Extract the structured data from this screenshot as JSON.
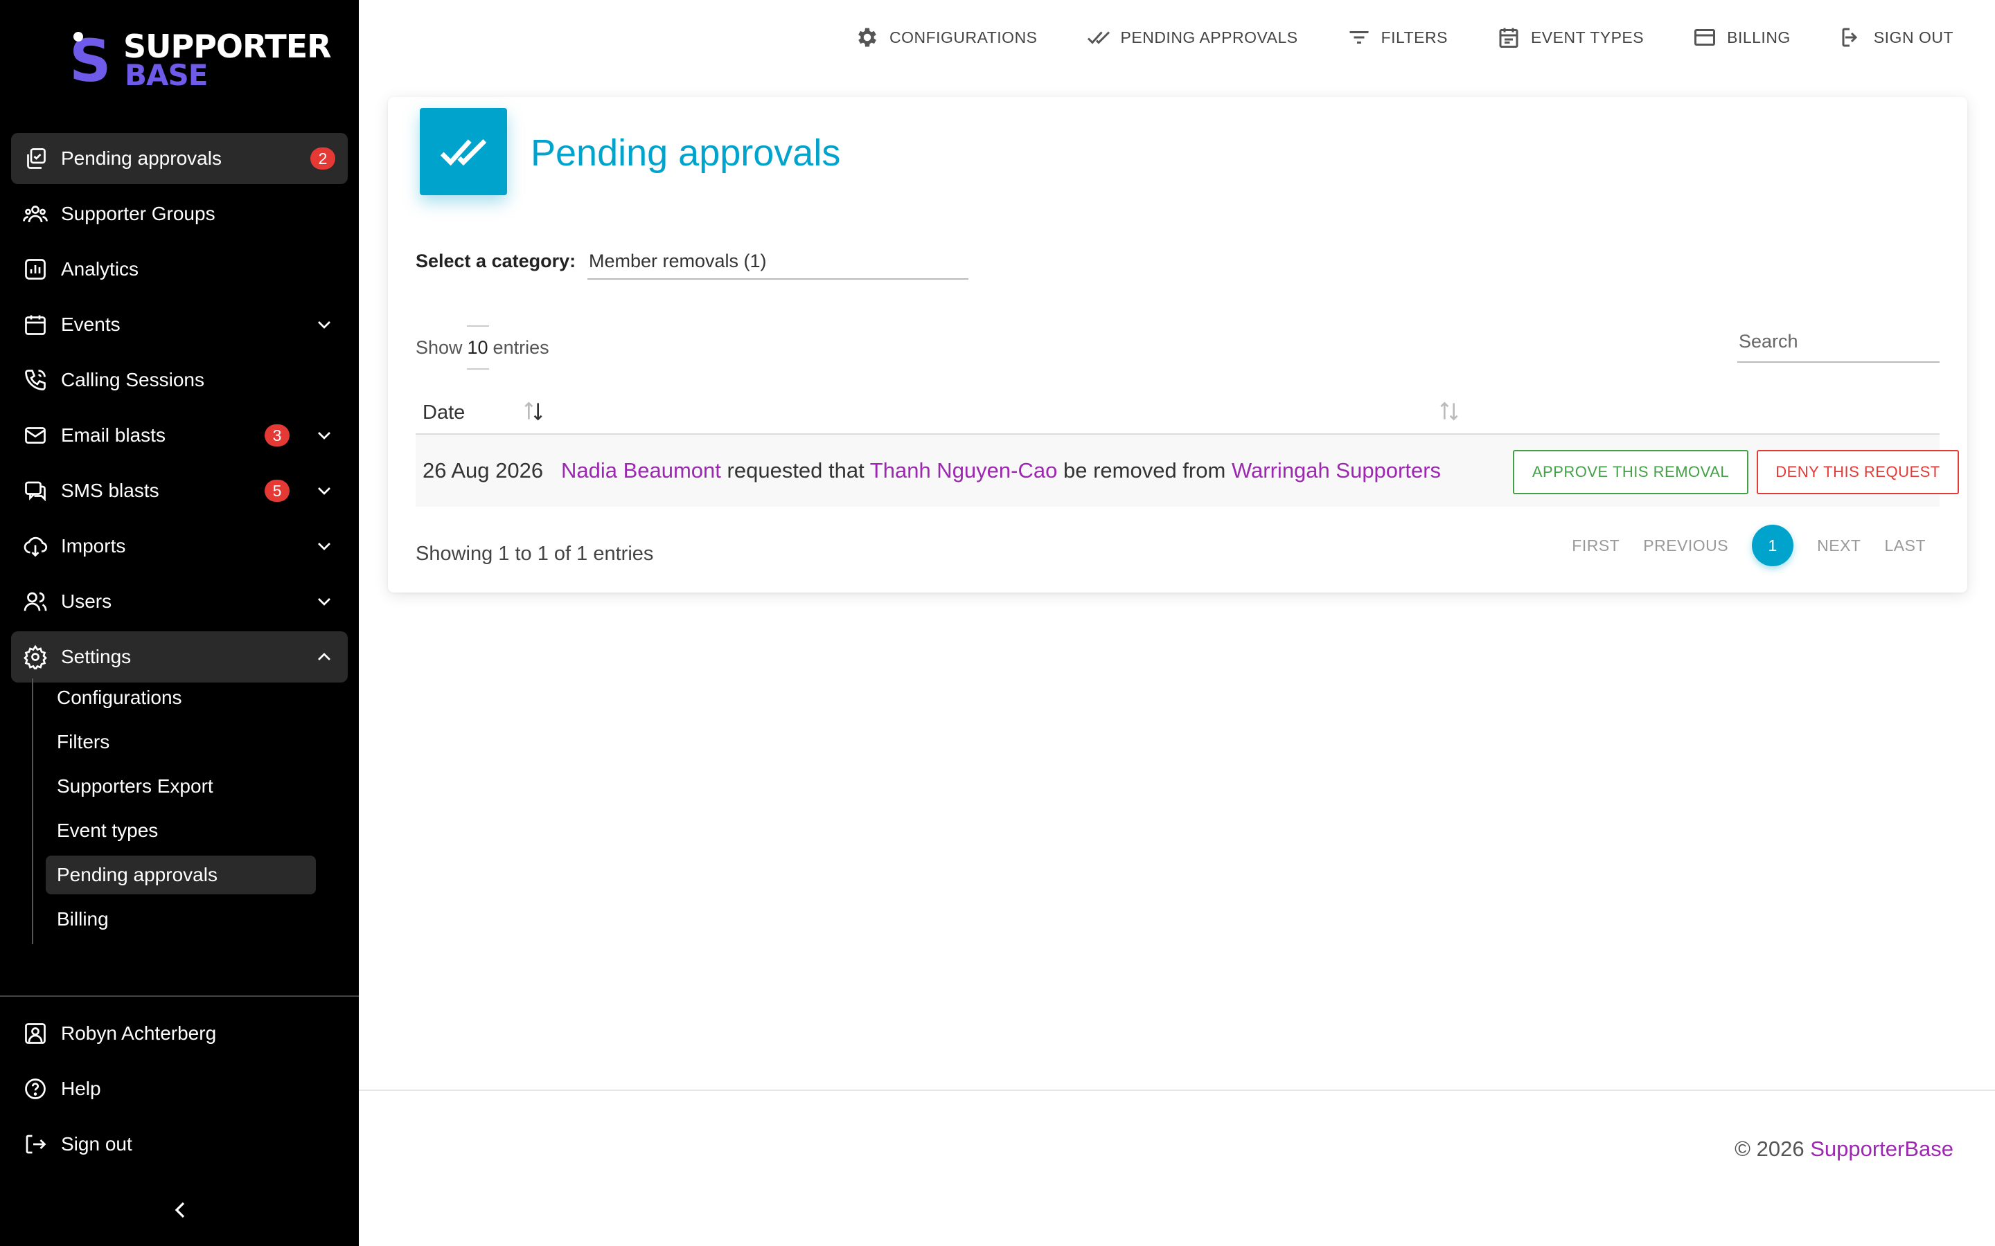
{
  "brand": {
    "logo_top": "SUPPORTER",
    "logo_bottom": "BASE",
    "accent": "#6f5bea"
  },
  "sidebar": {
    "items": [
      {
        "label": "Pending approvals",
        "icon": "approvals-icon",
        "badge": "2",
        "active": true
      },
      {
        "label": "Supporter Groups",
        "icon": "groups-icon"
      },
      {
        "label": "Analytics",
        "icon": "analytics-icon"
      },
      {
        "label": "Events",
        "icon": "calendar-icon",
        "expandable": true
      },
      {
        "label": "Calling Sessions",
        "icon": "phone-icon"
      },
      {
        "label": "Email blasts",
        "icon": "mail-icon",
        "badge": "3",
        "expandable": true
      },
      {
        "label": "SMS blasts",
        "icon": "sms-icon",
        "badge": "5",
        "expandable": true
      },
      {
        "label": "Imports",
        "icon": "import-icon",
        "expandable": true
      },
      {
        "label": "Users",
        "icon": "users-icon",
        "expandable": true
      },
      {
        "label": "Settings",
        "icon": "gear-icon",
        "expanded": true
      }
    ],
    "settings_sub": [
      {
        "label": "Configurations"
      },
      {
        "label": "Filters"
      },
      {
        "label": "Supporters Export"
      },
      {
        "label": "Event types"
      },
      {
        "label": "Pending approvals",
        "active": true
      },
      {
        "label": "Billing"
      }
    ],
    "footer": [
      {
        "label": "Robyn Achterberg",
        "icon": "account-icon"
      },
      {
        "label": "Help",
        "icon": "help-icon"
      },
      {
        "label": "Sign out",
        "icon": "signout-icon"
      }
    ]
  },
  "topbar": {
    "links": [
      {
        "label": "CONFIGURATIONS",
        "icon": "gear-icon"
      },
      {
        "label": "PENDING APPROVALS",
        "icon": "double-check-icon"
      },
      {
        "label": "FILTERS",
        "icon": "filter-icon"
      },
      {
        "label": "EVENT TYPES",
        "icon": "event-icon"
      },
      {
        "label": "BILLING",
        "icon": "card-icon"
      },
      {
        "label": "SIGN OUT",
        "icon": "exit-icon"
      }
    ]
  },
  "main": {
    "title": "Pending approvals",
    "title_color": "#00a3cc",
    "category_label": "Select a category:",
    "category_value": "Member removals (1)",
    "show_prefix": "Show",
    "show_value": "10",
    "show_suffix": "entries",
    "search_placeholder": "Search",
    "columns": [
      "Date"
    ],
    "rows": [
      {
        "date": "26 Aug 2026",
        "requester": "Nadia Beaumont",
        "text1": "requested that",
        "member": "Thanh Nguyen-Cao",
        "text2": "be removed from",
        "group": "Warringah Supporters",
        "approve_label": "APPROVE THIS REMOVAL",
        "deny_label": "DENY THIS REQUEST"
      }
    ],
    "showing": "Showing 1 to 1 of 1 entries",
    "pager": {
      "first": "FIRST",
      "previous": "PREVIOUS",
      "current": "1",
      "next": "NEXT",
      "last": "LAST"
    }
  },
  "footer": {
    "copyright": "© 2026",
    "brand_link": "SupporterBase"
  }
}
